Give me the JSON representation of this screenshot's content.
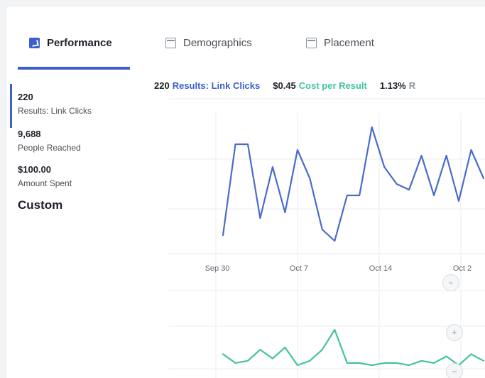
{
  "tabs": [
    {
      "label": "Performance",
      "active": true
    },
    {
      "label": "Demographics",
      "active": false
    },
    {
      "label": "Placement",
      "active": false
    }
  ],
  "sidebar": {
    "stats": [
      {
        "value": "220",
        "caption": "Results: Link Clicks"
      },
      {
        "value": "9,688",
        "caption": "People Reached"
      },
      {
        "value": "$100.00",
        "caption": "Amount Spent"
      }
    ],
    "custom_label": "Custom"
  },
  "summary": {
    "results_value": "220",
    "results_label": "Results: Link Clicks",
    "cost_value": "$0.45",
    "cost_label": "Cost per Result",
    "rate_value": "1.13%",
    "rate_label": "R"
  },
  "zoom": {
    "reset": "▫",
    "in": "+",
    "out": "−"
  },
  "colors": {
    "accent": "#3b5fcc",
    "results_line": "#4a6bcb",
    "cost_line": "#42c3a0",
    "grid": "#eceef1"
  },
  "chart_data": {
    "type": "line",
    "x_tick_labels": [
      "Sep 30",
      "Oct 7",
      "Oct 14",
      "Oct 2"
    ],
    "series": [
      {
        "name": "Results: Link Clicks",
        "values": [
          3,
          19,
          19,
          6,
          15,
          7,
          18,
          13,
          4,
          2,
          10,
          10,
          22,
          15,
          12,
          11,
          17,
          10,
          17,
          9,
          18,
          13
        ]
      },
      {
        "name": "Cost per Result",
        "values": [
          2,
          1.6,
          1.7,
          2.2,
          1.8,
          2.3,
          1.5,
          1.7,
          2.2,
          3.1,
          1.6,
          1.6,
          1.5,
          1.6,
          1.6,
          1.5,
          1.7,
          1.6,
          1.9,
          1.5,
          2,
          1.7
        ]
      }
    ]
  }
}
